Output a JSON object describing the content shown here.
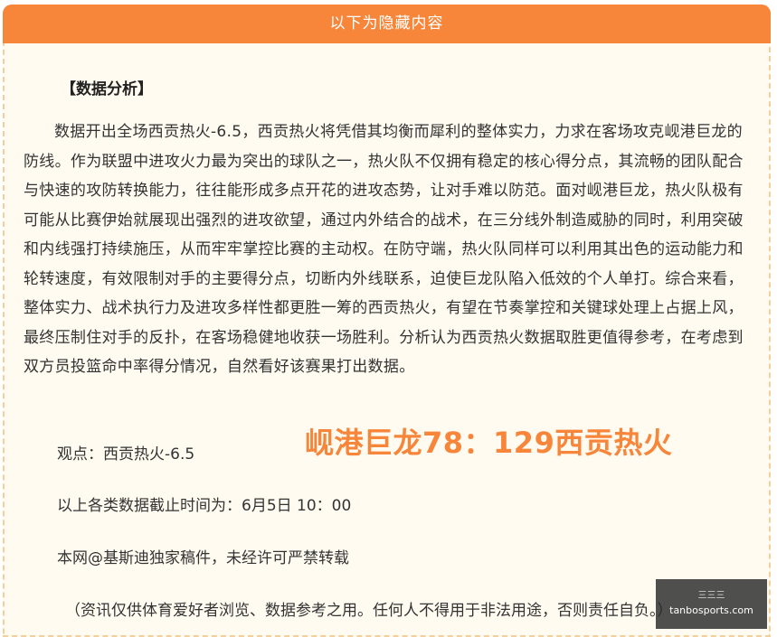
{
  "header": {
    "title": "以下为隐藏内容"
  },
  "article": {
    "section_heading": "【数据分析】",
    "analysis": "数据开出全场西贡热火-6.5，西贡热火将凭借其均衡而犀利的整体实力，力求在客场攻克岘港巨龙的防线。作为联盟中进攻火力最为突出的球队之一，热火队不仅拥有稳定的核心得分点，其流畅的团队配合与快速的攻防转换能力，往往能形成多点开花的进攻态势，让对手难以防范。面对岘港巨龙，热火队极有可能从比赛伊始就展现出强烈的进攻欲望，通过内外结合的战术，在三分线外制造威胁的同时，利用突破和内线强打持续施压，从而牢牢掌控比赛的主动权。在防守端，热火队同样可以利用其出色的运动能力和轮转速度，有效限制对手的主要得分点，切断内外线联系，迫使巨龙队陷入低效的个人单打。综合来看，整体实力、战术执行力及进攻多样性都更胜一筹的西贡热火，有望在节奏掌控和关键球处理上占据上风，最终压制住对手的反扑，在客场稳健地收获一场胜利。分析认为西贡热火数据取胜更值得参考，在考虑到双方员投篮命中率得分情况，自然看好该赛果打出数据。",
    "score": "岘港巨龙78：129西贡热火",
    "viewpoint": "观点：西贡热火-6.5",
    "cutoff": "以上各类数据截止时间为：6月5日 10：00",
    "copyright": "本网@基斯迪独家稿件，未经许可严禁转载",
    "disclaimer": "（资讯仅供体育爱好者浏览、数据参考之用。任何人不得用于非法用途，否则责任自负。）"
  },
  "watermark": {
    "top_text": "三三三",
    "site": "tanbosports.com"
  },
  "colors": {
    "accent": "#f7863a",
    "panel_bg": "#fffbf0",
    "border": "#f5cf9a",
    "text": "#333333"
  }
}
